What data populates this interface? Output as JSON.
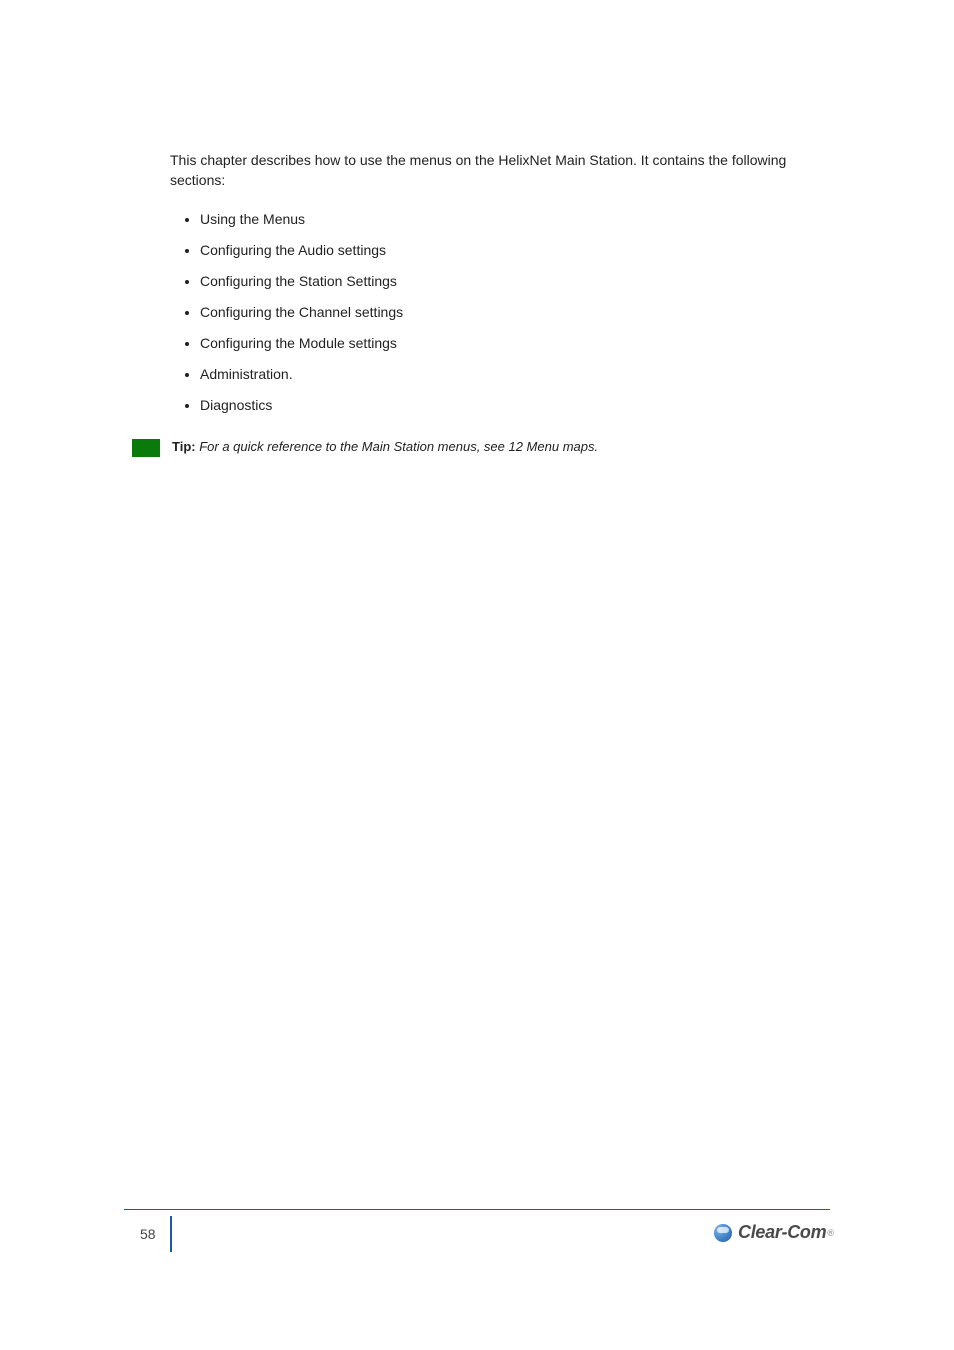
{
  "intro": "This chapter describes how to use the menus on the HelixNet Main Station. It contains the following sections:",
  "bullets": [
    "Using the Menus",
    "Configuring the Audio settings",
    "Configuring the Station Settings",
    "Configuring the Channel settings",
    "Configuring the Module settings",
    "Administration.",
    "Diagnostics"
  ],
  "tip": {
    "label": "Tip:",
    "body": "For a quick reference to the Main Station menus, see 12 Menu maps."
  },
  "footer": {
    "page_number": "58",
    "brand": "Clear-Com"
  }
}
